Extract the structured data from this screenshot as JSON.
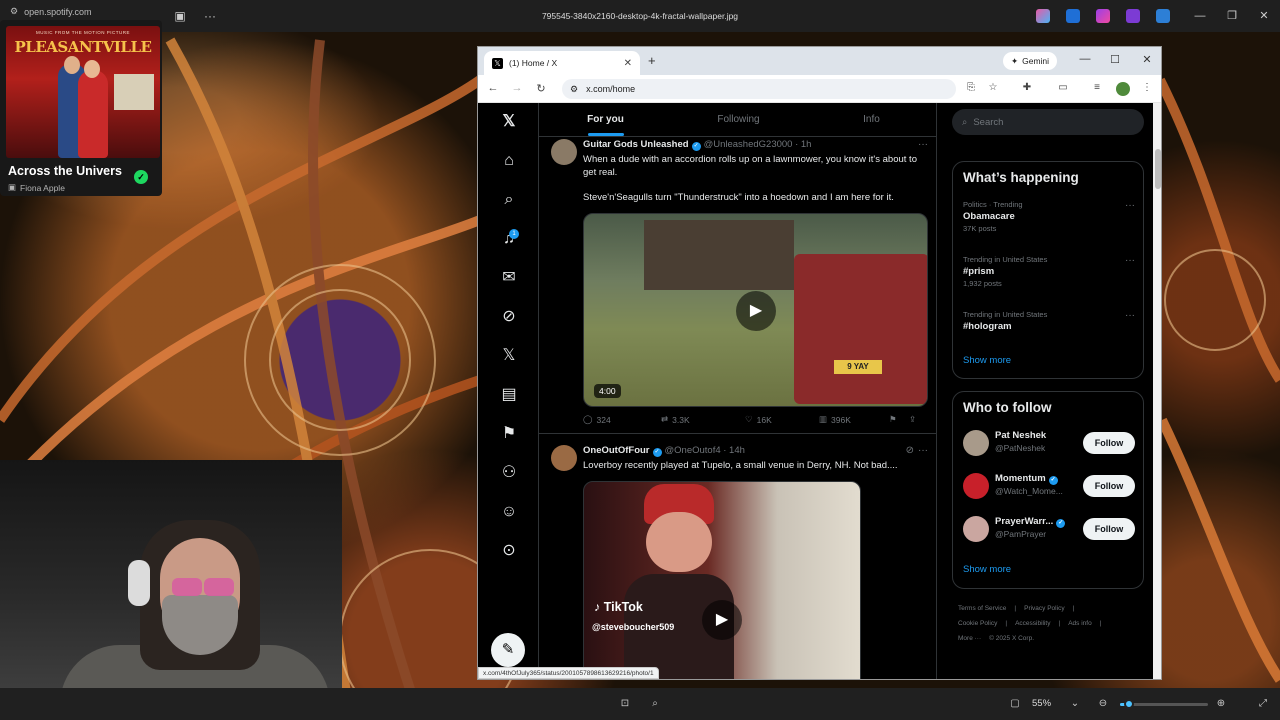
{
  "viewer": {
    "file_title": "795545-3840x2160-desktop-4k-fractal-wallpaper.jpg",
    "zoom": "55%",
    "zoom_level": 0.55
  },
  "spotify": {
    "source_url": "open.spotify.com",
    "album_caption": "MUSIC FROM THE MOTION PICTURE",
    "album_title": "PLEASANTVILLE",
    "track_title": "Across the Univers",
    "artist": "Fiona Apple"
  },
  "browser": {
    "tab_title": "(1) Home / X",
    "gemini_label": "Gemini",
    "url": "x.com/home",
    "status_url": "x.com/4thOfJuly365/status/2001057898613629216/photo/1"
  },
  "x": {
    "notification_count": "1",
    "feed_tabs": [
      "For you",
      "Following",
      "Info"
    ],
    "tweets": [
      {
        "name": "Guitar Gods Unleashed",
        "handle": "@UnleashedG23000 · 1h",
        "text1": "When a dude with an accordion rolls up on a lawnmower, you know it's about to get real.",
        "text2": "Steve'n'Seagulls turn \"Thunderstruck\" into a hoedown and I am here for it.",
        "duration": "4:00",
        "plate": "9 YAY",
        "stats": {
          "replies": "324",
          "reposts": "3.3K",
          "likes": "16K",
          "views": "396K"
        }
      },
      {
        "name": "OneOutOfFour",
        "handle": "@OneOutof4 · 14h",
        "text1": "Loverboy recently played at Tupelo, a small venue in Derry, NH. Not bad....",
        "tiktok_label": "TikTok",
        "tiktok_handle": "@steveboucher509"
      }
    ],
    "search_placeholder": "Search",
    "whats_happening": {
      "title": "What’s happening",
      "trends": [
        {
          "category": "Politics · Trending",
          "name": "Obamacare",
          "count": "37K posts"
        },
        {
          "category": "Trending in United States",
          "name": "#prism",
          "count": "1,932 posts"
        },
        {
          "category": "Trending in United States",
          "name": "#hologram",
          "count": ""
        }
      ],
      "show_more": "Show more"
    },
    "who_to_follow": {
      "title": "Who to follow",
      "users": [
        {
          "name": "Pat Neshek",
          "handle": "@PatNeshek",
          "button": "Follow"
        },
        {
          "name": "Momentum",
          "handle": "@Watch_Mome...",
          "button": "Follow"
        },
        {
          "name": "PrayerWarr...",
          "handle": "@PamPrayer",
          "button": "Follow"
        }
      ],
      "show_more": "Show more"
    },
    "legal": [
      "Terms of Service",
      "|",
      "Privacy Policy",
      "|",
      "Cookie Policy",
      "|",
      "Accessibility",
      "|",
      "Ads info",
      "|",
      "More ···",
      "© 2025 X Corp."
    ]
  }
}
